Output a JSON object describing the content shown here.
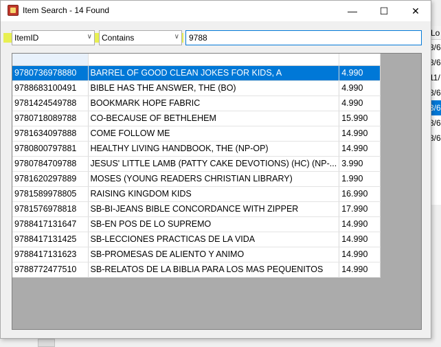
{
  "window": {
    "title": "Item Search - 14 Found",
    "minimize_glyph": "—",
    "maximize_glyph": "☐",
    "close_glyph": "✕"
  },
  "filters": {
    "field": "ItemID",
    "operator": "Contains",
    "search_value": "9788"
  },
  "results": {
    "selected_index": 0,
    "rows": [
      {
        "id": "9780736978880",
        "title": "BARREL OF GOOD CLEAN JOKES FOR KIDS, A",
        "price": "4.990"
      },
      {
        "id": "9788683100491",
        "title": "BIBLE HAS THE ANSWER, THE (BO)",
        "price": "4.990"
      },
      {
        "id": "9781424549788",
        "title": "BOOKMARK HOPE FABRIC",
        "price": "4.990"
      },
      {
        "id": "9780718089788",
        "title": "CO-BECAUSE OF BETHLEHEM",
        "price": "15.990"
      },
      {
        "id": "9781634097888",
        "title": "COME FOLLOW ME",
        "price": "14.990"
      },
      {
        "id": "9780800797881",
        "title": "HEALTHY LIVING HANDBOOK, THE (NP-OP)",
        "price": "14.990"
      },
      {
        "id": "9780784709788",
        "title": "JESUS' LITTLE LAMB (PATTY CAKE DEVOTIONS) (HC) (NP-...",
        "price": "3.990"
      },
      {
        "id": "9781620297889",
        "title": "MOSES (YOUNG READERS CHRISTIAN LIBRARY)",
        "price": "1.990"
      },
      {
        "id": "9781589978805",
        "title": "RAISING KINGDOM KIDS",
        "price": "16.990"
      },
      {
        "id": "9781576978818",
        "title": "SB-BI-JEANS BIBLE CONCORDANCE WITH ZIPPER",
        "price": "17.990"
      },
      {
        "id": "9788417131647",
        "title": "SB-EN POS DE LO SUPREMO",
        "price": "14.990"
      },
      {
        "id": "9788417131425",
        "title": "SB-LECCIONES PRACTICAS DE LA VIDA",
        "price": "14.990"
      },
      {
        "id": "9788417131623",
        "title": "SB-PROMESAS DE ALIENTO Y ANIMO",
        "price": "14.990"
      },
      {
        "id": "9788772477510",
        "title": "SB-RELATOS DE LA BIBLIA PARA LOS MAS PEQUENITOS",
        "price": "14.990"
      }
    ]
  },
  "background_app": {
    "header": "Lo",
    "rows": [
      "3/6,",
      "3/6,",
      "11/",
      "3/6,",
      "3/6,",
      "3/6,",
      "3/6,"
    ],
    "selected_index": 4
  }
}
